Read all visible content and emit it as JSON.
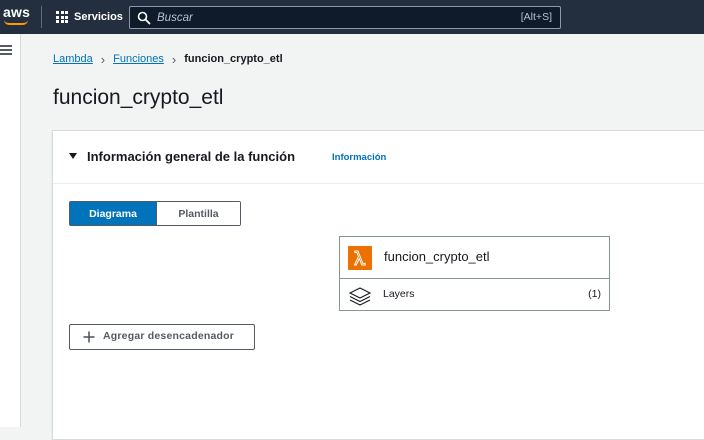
{
  "topnav": {
    "logo_text": "aws",
    "services_label": "Servicios",
    "search_placeholder": "Buscar",
    "search_shortcut": "[Alt+S]"
  },
  "breadcrumb": {
    "items": [
      "Lambda",
      "Funciones"
    ],
    "current": "funcion_crypto_etl"
  },
  "page": {
    "title": "funcion_crypto_etl"
  },
  "panel": {
    "title": "Información general de la función",
    "info_link": "Información",
    "tabs": [
      {
        "label": "Diagrama",
        "active": true
      },
      {
        "label": "Plantilla",
        "active": false
      }
    ],
    "function_card": {
      "name": "funcion_crypto_etl",
      "icon": "lambda-icon",
      "layers_label": "Layers",
      "layers_count": "(1)"
    },
    "add_trigger_label": "Agregar desencadenador"
  },
  "colors": {
    "nav_bg": "#232f3e",
    "link": "#0073bb",
    "primary": "#0073bb",
    "lambda_orange": "#ed7100"
  }
}
